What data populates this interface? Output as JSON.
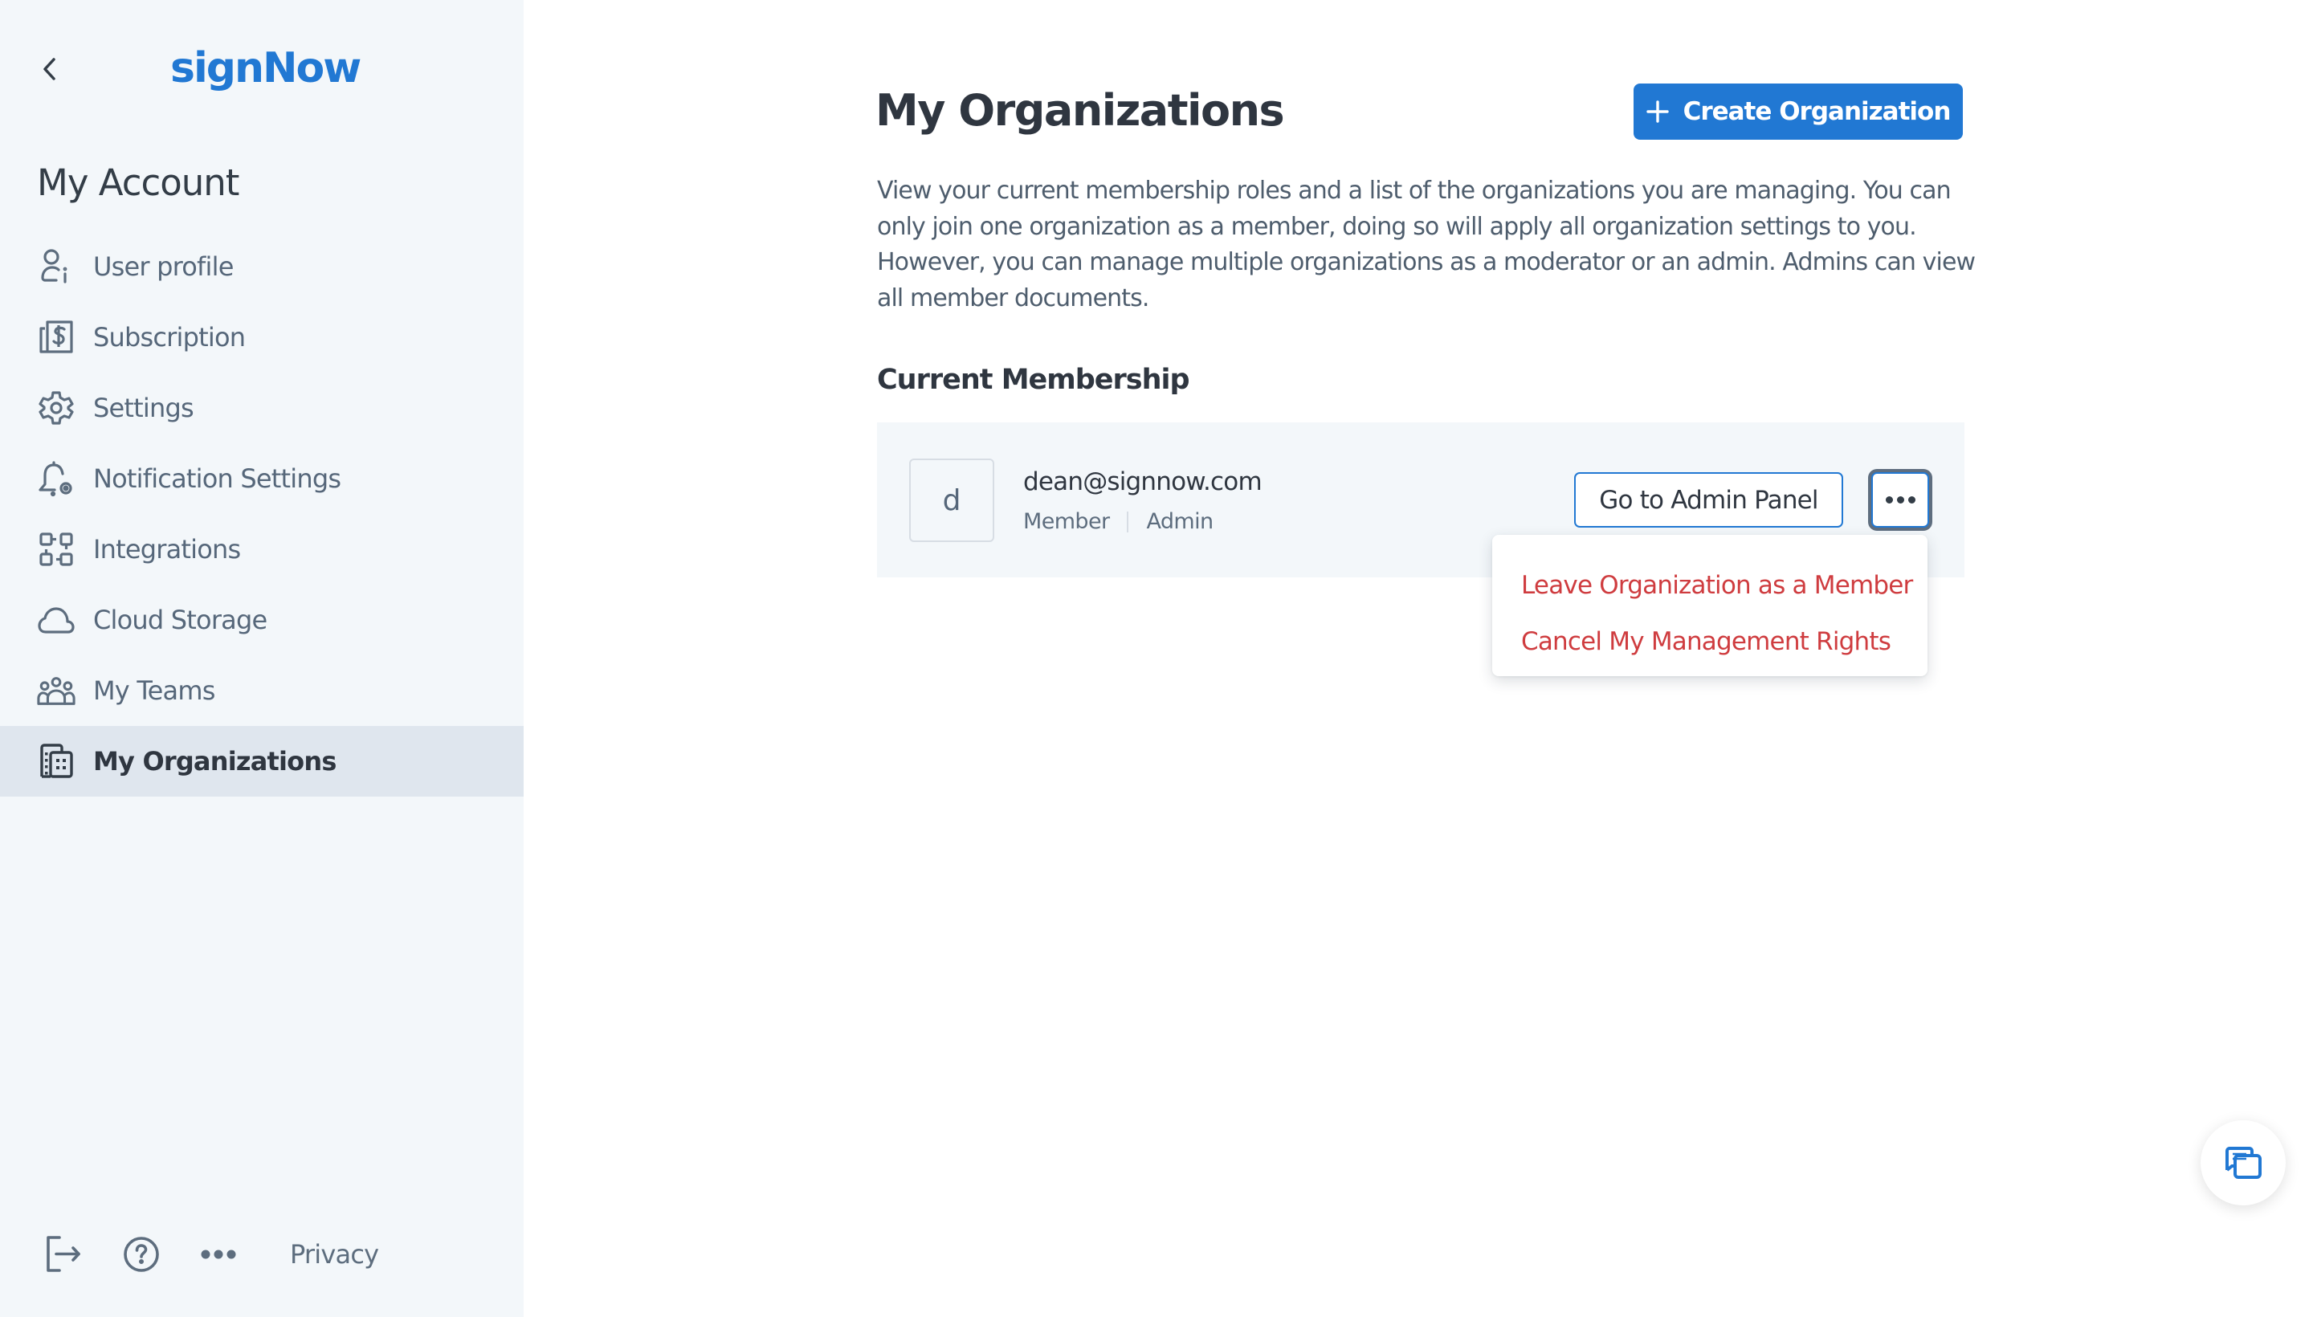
{
  "brand": {
    "logo_text": "signNow",
    "color": "#2178d3"
  },
  "sidebar": {
    "back_icon": "chevron-left-icon",
    "title": "My Account",
    "items": [
      {
        "label": "User profile",
        "icon": "user-info-icon",
        "active": false
      },
      {
        "label": "Subscription",
        "icon": "subscription-dollar-icon",
        "active": false
      },
      {
        "label": "Settings",
        "icon": "gear-icon",
        "active": false
      },
      {
        "label": "Notification Settings",
        "icon": "bell-gear-icon",
        "active": false
      },
      {
        "label": "Integrations",
        "icon": "integrations-icon",
        "active": false
      },
      {
        "label": "Cloud Storage",
        "icon": "cloud-icon",
        "active": false
      },
      {
        "label": "My Teams",
        "icon": "team-icon",
        "active": false
      },
      {
        "label": "My Organizations",
        "icon": "building-icon",
        "active": true
      }
    ],
    "footer": {
      "logout_icon": "logout-icon",
      "help_icon": "help-icon",
      "more_icon": "more-horizontal-icon",
      "privacy_label": "Privacy"
    }
  },
  "main": {
    "title": "My Organizations",
    "create_button": {
      "label": "Create Organization",
      "icon": "plus-icon"
    },
    "description": "View your current membership roles and a list of the organizations you are managing. You can only join one organization as a member, doing so will apply all organization settings to you. However, you can manage multiple organizations as a moderator or an admin. Admins can view all member documents.",
    "section_title": "Current Membership",
    "membership": {
      "avatar_letter": "d",
      "email": "dean@signnow.com",
      "roles": [
        "Member",
        "Admin"
      ],
      "admin_button_label": "Go to Admin Panel",
      "more_icon": "more-horizontal-icon"
    },
    "dropdown": {
      "items": [
        {
          "label": "Leave Organization as a Member",
          "color": "#cf3c3f"
        },
        {
          "label": "Cancel My Management Rights",
          "color": "#cf3c3f"
        }
      ]
    }
  },
  "chat_widget": {
    "icon": "chat-bubbles-icon"
  }
}
